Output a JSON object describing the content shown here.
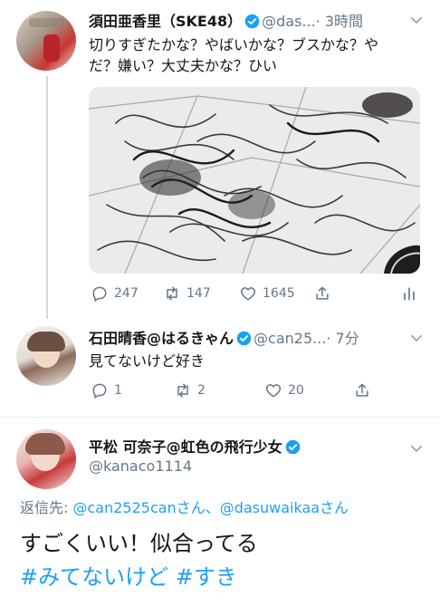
{
  "tweet1": {
    "name": "須田亜香里（SKE48）",
    "handle": "@das...",
    "time": "· 3時間",
    "text_line1": "切りすぎたかな？やばいかな？ブスかな？や",
    "text_line2": "だ？嫌い？大丈夫かな？ひい",
    "replies": "247",
    "retweets": "147",
    "likes": "1645"
  },
  "tweet2": {
    "name": "石田晴香@はるきゃん",
    "handle": "@can25...",
    "time": "· 7分",
    "text": "見てないけど好き",
    "replies": "1",
    "retweets": "2",
    "likes": "20"
  },
  "tweet3": {
    "name": "平松 可奈子@虹色の飛行少女",
    "handle": "@kanaco1114",
    "reply_prefix": "返信先: ",
    "reply_to": "@can2525canさん、@dasuwaikaaさん",
    "text": "すごくいい！似合ってる",
    "hashtags": "#みてないけど #すき"
  },
  "colors": {
    "accent": "#1da1f2",
    "muted": "#657786"
  }
}
